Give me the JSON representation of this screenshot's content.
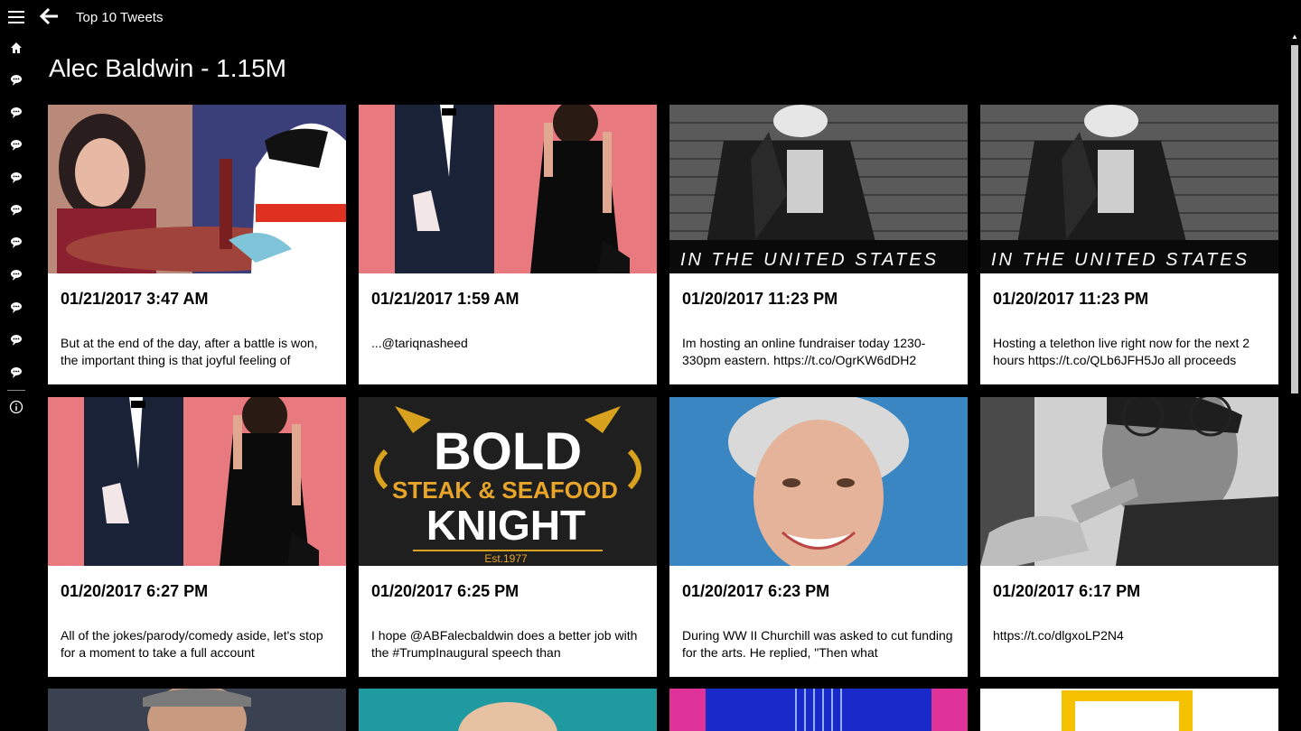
{
  "app": {
    "title": "Top 10 Tweets"
  },
  "page": {
    "title": "Alec Baldwin - 1.15M"
  },
  "sidebar": {
    "items": [
      {
        "name": "home-icon"
      },
      {
        "name": "tweet-icon"
      },
      {
        "name": "tweet-icon"
      },
      {
        "name": "tweet-icon"
      },
      {
        "name": "tweet-icon"
      },
      {
        "name": "tweet-icon"
      },
      {
        "name": "tweet-icon"
      },
      {
        "name": "tweet-icon"
      },
      {
        "name": "tweet-icon"
      },
      {
        "name": "tweet-icon"
      },
      {
        "name": "tweet-icon"
      },
      {
        "name": "info-icon"
      }
    ]
  },
  "tweets": [
    {
      "date": "01/21/2017 3:47 AM",
      "text": "But at the end of the day, after a battle is won, the important thing is that joyful feeling of",
      "image": "cartoon-scene"
    },
    {
      "date": "01/21/2017 1:59 AM",
      "text": "...@tariqnasheed",
      "image": "red-carpet-couple"
    },
    {
      "date": "01/20/2017 11:23 PM",
      "text": "Im hosting an online fundraiser today 1230-330pm eastern. https://t.co/OgrKW6dDH2",
      "image": "in-the-united-states-poster",
      "caption": "IN THE UNITED STATES"
    },
    {
      "date": "01/20/2017 11:23 PM",
      "text": "Hosting a telethon live right now for the next 2 hours https://t.co/QLb6JFH5Jo all proceeds",
      "image": "in-the-united-states-poster",
      "caption": "IN THE UNITED STATES"
    },
    {
      "date": "01/20/2017 6:27 PM",
      "text": "All of the jokes/parody/comedy aside, let's stop for a moment to take a full account",
      "image": "red-carpet-couple"
    },
    {
      "date": "01/20/2017 6:25 PM",
      "text": "I hope @ABFalecbaldwin does a better job with the #TrumpInaugural speech than",
      "image": "bold-knight-logo",
      "logo": {
        "line1": "BOLD",
        "line2": "STEAK & SEAFOOD",
        "line3": "KNIGHT",
        "line4": "Est.1977"
      }
    },
    {
      "date": "01/20/2017 6:23 PM",
      "text": "During WW II Churchill was asked to cut funding for the arts. He replied, \"Then what",
      "image": "smiling-woman-portrait"
    },
    {
      "date": "01/20/2017 6:17 PM",
      "text": "https://t.co/dlgxoLP2N4",
      "image": "man-gesturing-bw"
    }
  ],
  "partial_row": [
    "man-portrait",
    "bald-head",
    "neon-stage",
    "yellow-frame-logo"
  ]
}
